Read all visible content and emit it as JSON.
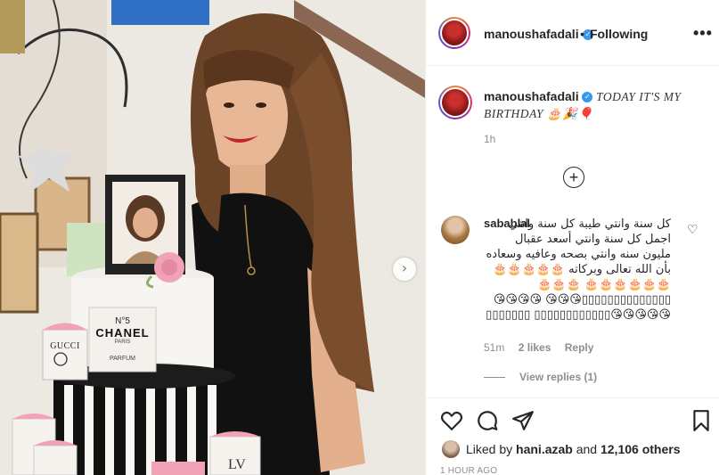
{
  "header": {
    "username": "manoushafadali",
    "separator": "•",
    "follow_status": "Following",
    "more": "•••",
    "verified": "✓"
  },
  "caption": {
    "username": "manoushafadali",
    "text": "TODAY IT'S MY BIRTHDAY 🎂🎉🎈",
    "time": "1h"
  },
  "load_more": "+",
  "comment": {
    "username": "sabablal",
    "text": "كل سنة وانتي طيبة كل سنة وانتي اجمل كل سنة وانتي أسعد عقبال مليون سنه وانتي بصحه وعافيه وسعاده بأن الله تعالى وبركاته 🎂🎂🎂🎂🎂🎂🎂🎂🎂🎂🎂 🎂🎂🎂▯▯▯▯▯▯▯▯▯▯▯▯▯▯😘😘😘 😘😘😘😘😘😘😘😘😘▯▯▯▯▯▯▯▯▯▯▯▯ ▯▯▯▯▯▯▯",
    "time": "51m",
    "likes": "2 likes",
    "reply": "Reply",
    "view_replies": "View replies (1)"
  },
  "likes_bar": {
    "liked_by_prefix": "Liked by",
    "liked_by_user": "hani.azab",
    "and": "and",
    "others": "12,106 others",
    "time": "1 HOUR AGO"
  },
  "photo": {
    "cake_brand_top": "N°5",
    "cake_brand": "CHANEL",
    "cake_city": "PARIS",
    "cake_parfum": "PARFUM",
    "gucci": "GUCCI"
  },
  "icons": {
    "heart": "heart-icon",
    "comment": "comment-icon",
    "share": "share-icon",
    "save": "bookmark-icon"
  },
  "colors": {
    "verified_blue": "#3897f0",
    "meta_gray": "#8e8e8e",
    "text": "#262626"
  }
}
